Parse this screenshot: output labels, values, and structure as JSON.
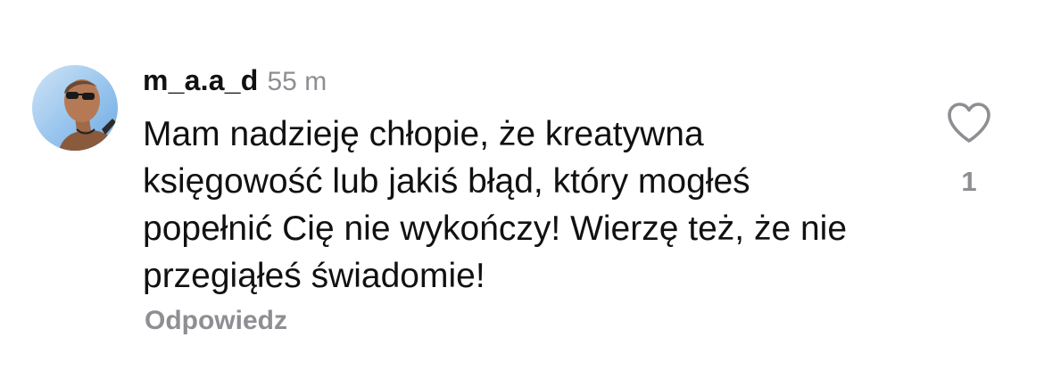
{
  "comment": {
    "username": "m_a.a_d",
    "time_ago": "55 m",
    "text": "Mam nadzieję chłopie, że kreatywna księgowość lub jakiś błąd, który mogłeś popełnić Cię nie wykończy! Wierzę też, że nie przegiąłeś świadomie!",
    "reply_label": "Odpowiedz",
    "like_count": "1",
    "like_icon": "heart-outline-icon"
  },
  "colors": {
    "text": "#111111",
    "muted": "#8e8e93",
    "background": "#ffffff"
  }
}
